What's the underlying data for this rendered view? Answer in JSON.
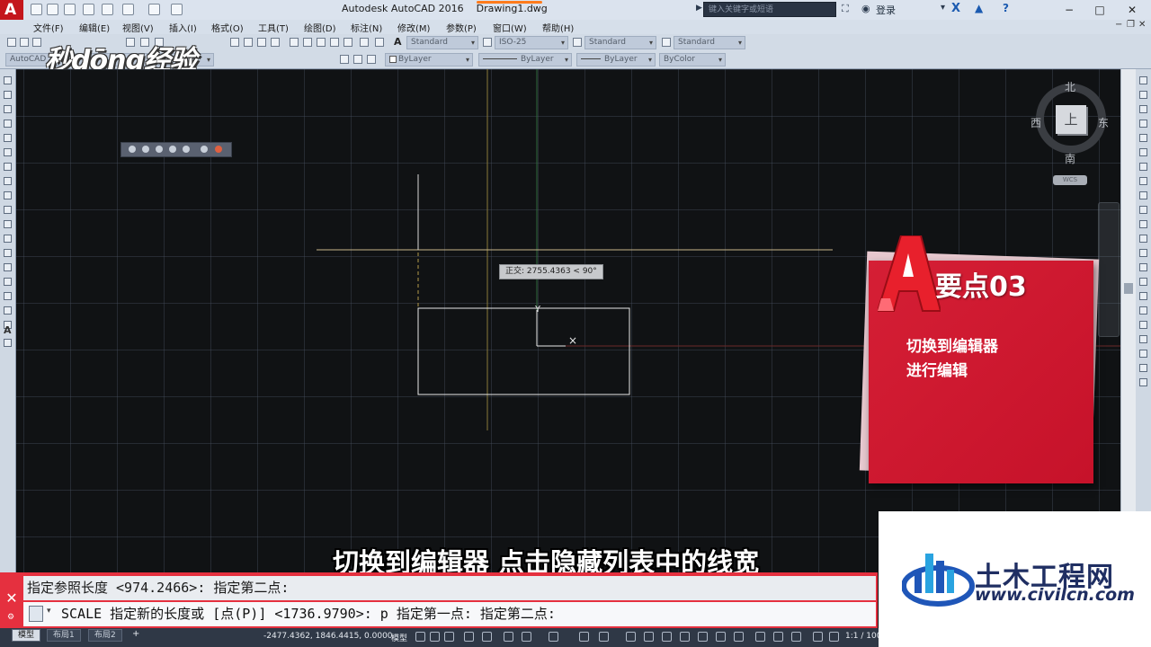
{
  "window": {
    "app_title": "Autodesk AutoCAD 2016",
    "file_name": "Drawing1.dwg",
    "search_placeholder": "键入关键字或短语",
    "login_label": "登录"
  },
  "menu": [
    "文件(F)",
    "编辑(E)",
    "视图(V)",
    "插入(I)",
    "格式(O)",
    "工具(T)",
    "绘图(D)",
    "标注(N)",
    "修改(M)",
    "参数(P)",
    "窗口(W)",
    "帮助(H)"
  ],
  "toolbar": {
    "text_style": "Standard",
    "dim_style": "ISO-25",
    "table_style": "Standard",
    "multileader_style": "Standard",
    "workspace": "AutoCAD",
    "layer_color": "ByLayer",
    "linetype": "ByLayer",
    "lineweight": "ByLayer",
    "plot_style": "ByColor"
  },
  "watermark_logo": "秒dōng经验",
  "viewcube": {
    "face": "上",
    "north": "北",
    "south": "南",
    "east": "东",
    "west": "西",
    "wcs": "WCS"
  },
  "tooltip": "正交: 2755.4363 < 90°",
  "card": {
    "letter": "A",
    "heading": "要点03",
    "line1": "切换到编辑器",
    "line2": "进行编辑"
  },
  "subtitle": "切换到编辑器 点击隐藏列表中的线宽",
  "command_line": {
    "history": "指定参照长度 <974.2466>:  指定第二点:",
    "input": "SCALE 指定新的长度或 [点(P)] <1736.9790>:  p 指定第一点:  指定第二点:"
  },
  "status_bar": {
    "tabs": [
      "模型",
      "布局1",
      "布局2"
    ],
    "coordinates": "-2477.4362, 1846.4415, 0.0000",
    "model_label": "模型",
    "scale": "1:1 / 100%"
  },
  "site_logo": {
    "name": "土木工程网",
    "url": "www.civilcn.com"
  },
  "colors": {
    "app_red": "#c4161c",
    "card_red": "#d51f35",
    "command_red": "#e5303f",
    "site_blue": "#1f2e62"
  }
}
